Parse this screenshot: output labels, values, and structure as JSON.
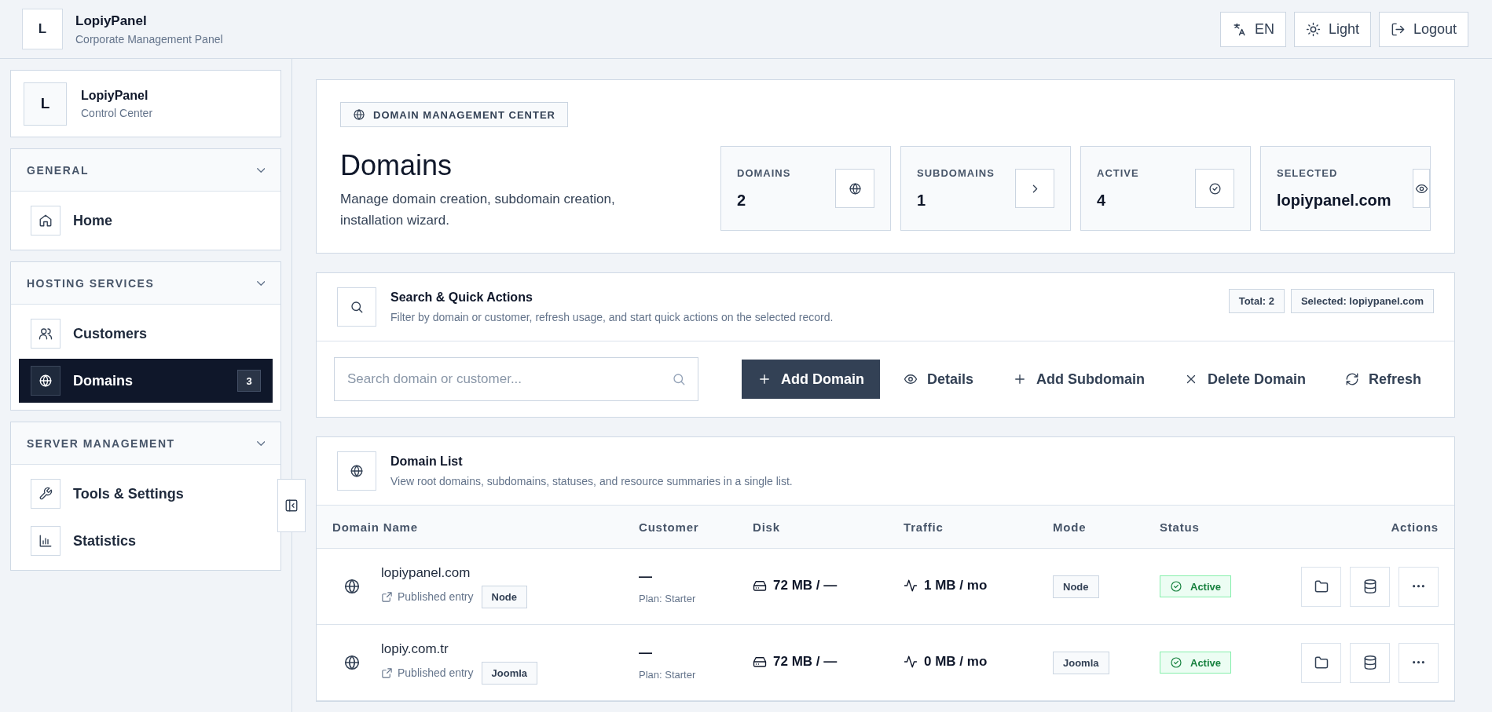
{
  "header": {
    "logo_letter": "L",
    "title": "LopiyPanel",
    "subtitle": "Corporate Management Panel",
    "buttons": [
      "EN",
      "Light",
      "Logout"
    ]
  },
  "sidebar": {
    "brand": {
      "letter": "L",
      "title": "LopiyPanel",
      "subtitle": "Control Center"
    },
    "sections": [
      {
        "title": "GENERAL",
        "expanded": true,
        "items": [
          {
            "label": "Home",
            "selected": false
          }
        ]
      },
      {
        "title": "HOSTING SERVICES",
        "expanded": true,
        "items": [
          {
            "label": "Customers",
            "selected": false
          },
          {
            "label": "Domains",
            "selected": true,
            "badge": "3"
          }
        ]
      },
      {
        "title": "SERVER MANAGEMENT",
        "expanded": true,
        "items": [
          {
            "label": "Tools & Settings",
            "selected": false
          },
          {
            "label": "Statistics",
            "selected": false
          }
        ]
      }
    ]
  },
  "hero": {
    "tag": "DOMAIN MANAGEMENT CENTER",
    "title": "Domains",
    "description": "Manage domain creation, subdomain creation, installation wizard.",
    "stats": [
      {
        "label": "DOMAINS",
        "value": "2"
      },
      {
        "label": "SUBDOMAINS",
        "value": "1"
      },
      {
        "label": "ACTIVE",
        "value": "4"
      },
      {
        "label": "SELECTED",
        "value": "lopiypanel.com"
      }
    ]
  },
  "search_panel": {
    "title": "Search & Quick Actions",
    "description": "Filter by domain or customer, refresh usage, and start quick actions on the selected record.",
    "badges": [
      "Total: 2",
      "Selected: lopiypanel.com"
    ],
    "placeholder": "Search domain or customer...",
    "actions": [
      {
        "label": "Add Domain",
        "kind": "primary"
      },
      {
        "label": "Details",
        "kind": "plain"
      },
      {
        "label": "Add Subdomain",
        "kind": "plain"
      },
      {
        "label": "Delete Domain",
        "kind": "plain"
      },
      {
        "label": "Refresh",
        "kind": "plain"
      }
    ]
  },
  "domain_list": {
    "title": "Domain List",
    "description": "View root domains, subdomains, statuses, and resource summaries in a single list.",
    "columns": [
      "Domain Name",
      "Customer",
      "Disk",
      "Traffic",
      "Mode",
      "Status",
      "Actions"
    ],
    "rows": [
      {
        "name": "lopiypanel.com",
        "entry": "Published entry",
        "entry_badge": "Node",
        "customer": "—",
        "plan": "Plan: Starter",
        "disk": "72 MB / —",
        "traffic": "1 MB / mo",
        "mode": "Node",
        "status": "Active"
      },
      {
        "name": "lopiy.com.tr",
        "entry": "Published entry",
        "entry_badge": "Joomla",
        "customer": "—",
        "plan": "Plan: Starter",
        "disk": "72 MB / —",
        "traffic": "0 MB / mo",
        "mode": "Joomla",
        "status": "Active"
      }
    ]
  }
}
